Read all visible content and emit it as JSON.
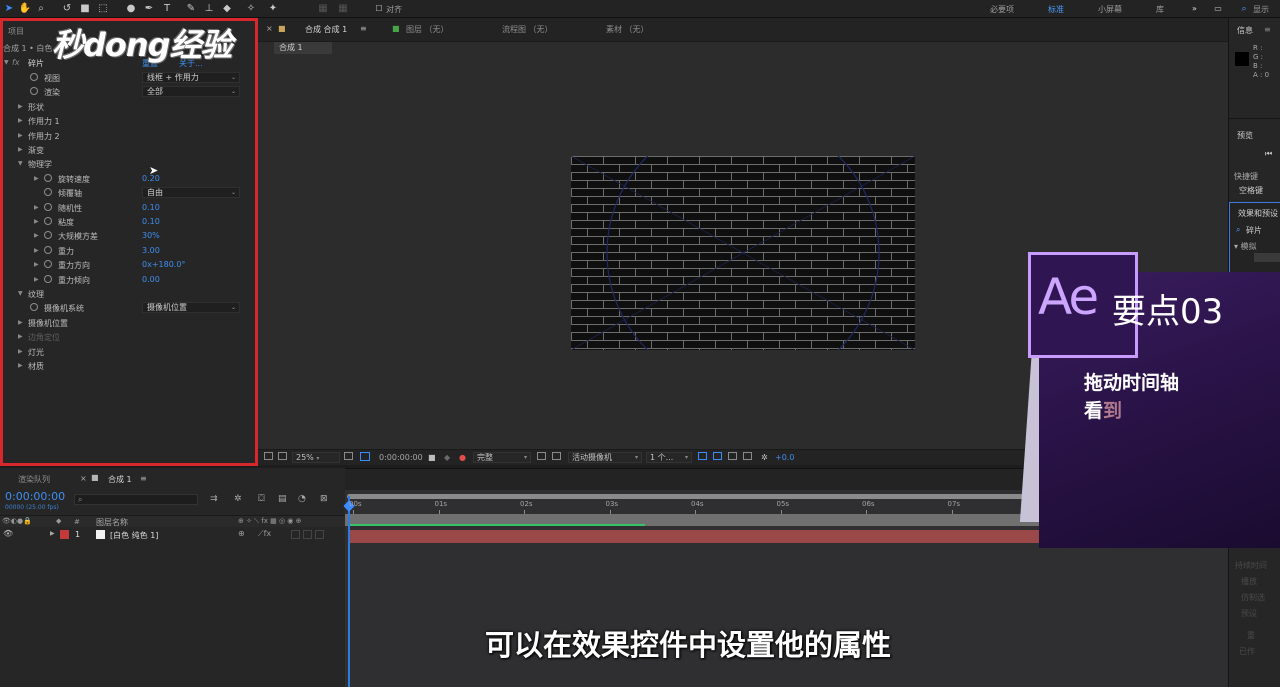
{
  "toolbar": {
    "snap_label": "对齐",
    "workspaces": [
      "必要项",
      "标准",
      "小屏幕",
      "库"
    ],
    "search_label": "显示"
  },
  "left_panel": {
    "tab_project": "项目",
    "layer_path": "合成 1 • 白色",
    "effect_name": "碎片",
    "reset_label": "重置",
    "about_label": "关于...",
    "properties": [
      {
        "label": "视图",
        "value": "线框 + 作用力",
        "kind": "dropdown",
        "indent": 2
      },
      {
        "label": "渲染",
        "value": "全部",
        "kind": "dropdown",
        "indent": 2
      },
      {
        "label": "形状",
        "kind": "group",
        "indent": 1
      },
      {
        "label": "作用力 1",
        "kind": "group",
        "indent": 1
      },
      {
        "label": "作用力 2",
        "kind": "group",
        "indent": 1
      },
      {
        "label": "渐变",
        "kind": "group",
        "indent": 1
      },
      {
        "label": "物理学",
        "kind": "group-open",
        "indent": 1
      },
      {
        "label": "旋转速度",
        "value": "0.20",
        "kind": "value",
        "indent": 3
      },
      {
        "label": "倾覆轴",
        "value": "自由",
        "kind": "dropdown",
        "indent": 3
      },
      {
        "label": "随机性",
        "value": "0.10",
        "kind": "value",
        "indent": 3
      },
      {
        "label": "粘度",
        "value": "0.10",
        "kind": "value",
        "indent": 3
      },
      {
        "label": "大规模方差",
        "value": "30%",
        "kind": "value",
        "indent": 3
      },
      {
        "label": "重力",
        "value": "3.00",
        "kind": "value",
        "indent": 3
      },
      {
        "label": "重力方向",
        "value": "0x+180.0°",
        "kind": "value",
        "indent": 3
      },
      {
        "label": "重力倾向",
        "value": "0.00",
        "kind": "value",
        "indent": 3
      },
      {
        "label": "纹理",
        "kind": "group-open",
        "indent": 1
      },
      {
        "label": "摄像机系统",
        "value": "摄像机位置",
        "kind": "dropdown",
        "indent": 2
      },
      {
        "label": "摄像机位置",
        "kind": "group",
        "indent": 1
      },
      {
        "label": "边角定位",
        "kind": "group-dim",
        "indent": 1
      },
      {
        "label": "灯光",
        "kind": "group",
        "indent": 1
      },
      {
        "label": "材质",
        "kind": "group",
        "indent": 1
      }
    ]
  },
  "viewer": {
    "tab_comp": "合成 合成 1",
    "tab_layer": "图层 （无）",
    "tab_flow": "流程图 （无）",
    "tab_footage": "素材 （无）",
    "comp_chip": "合成 1",
    "zoom": "25%",
    "timecode": "0:00:00:00",
    "resolution": "完整",
    "camera": "活动摄像机",
    "views": "1 个...",
    "exposure": "+0.0"
  },
  "right_panel": {
    "info_title": "信息",
    "channels": [
      "R :",
      "G :",
      "B :",
      "A : 0"
    ],
    "preview_title": "预览",
    "shortcut_label": "快捷键",
    "shortcut_value": "空格键",
    "effects_title": "效果和预设",
    "effects_search": "碎片",
    "category": "▾ 模拟",
    "faded_rows": [
      "持续时间",
      "播放",
      "仿制选",
      "预设",
      "重",
      "已作"
    ]
  },
  "timeline": {
    "tab_render": "渲染队列",
    "tab_comp": "合成 1",
    "timecode": "0:00:00:00",
    "fps": "00000 (25.00 fps)",
    "col_name": "图层名称",
    "col_num": "#",
    "layer_num": "1",
    "layer_name": "[白色 纯色 1]",
    "ruler": [
      "00s",
      "01s",
      "02s",
      "03s",
      "04s",
      "05s",
      "06s",
      "07s"
    ]
  },
  "watermark": "秒dong经验",
  "card": {
    "logo": "Ae",
    "title": "要点03",
    "line1": "拖动时间轴",
    "line2_a": "看",
    "line2_b": "到"
  },
  "subtitle": "可以在效果控件中设置他的属性",
  "colors": {
    "highlight_border": "#d9272e",
    "value_blue": "#3f8ef0",
    "card_purple": "#2a1348"
  }
}
